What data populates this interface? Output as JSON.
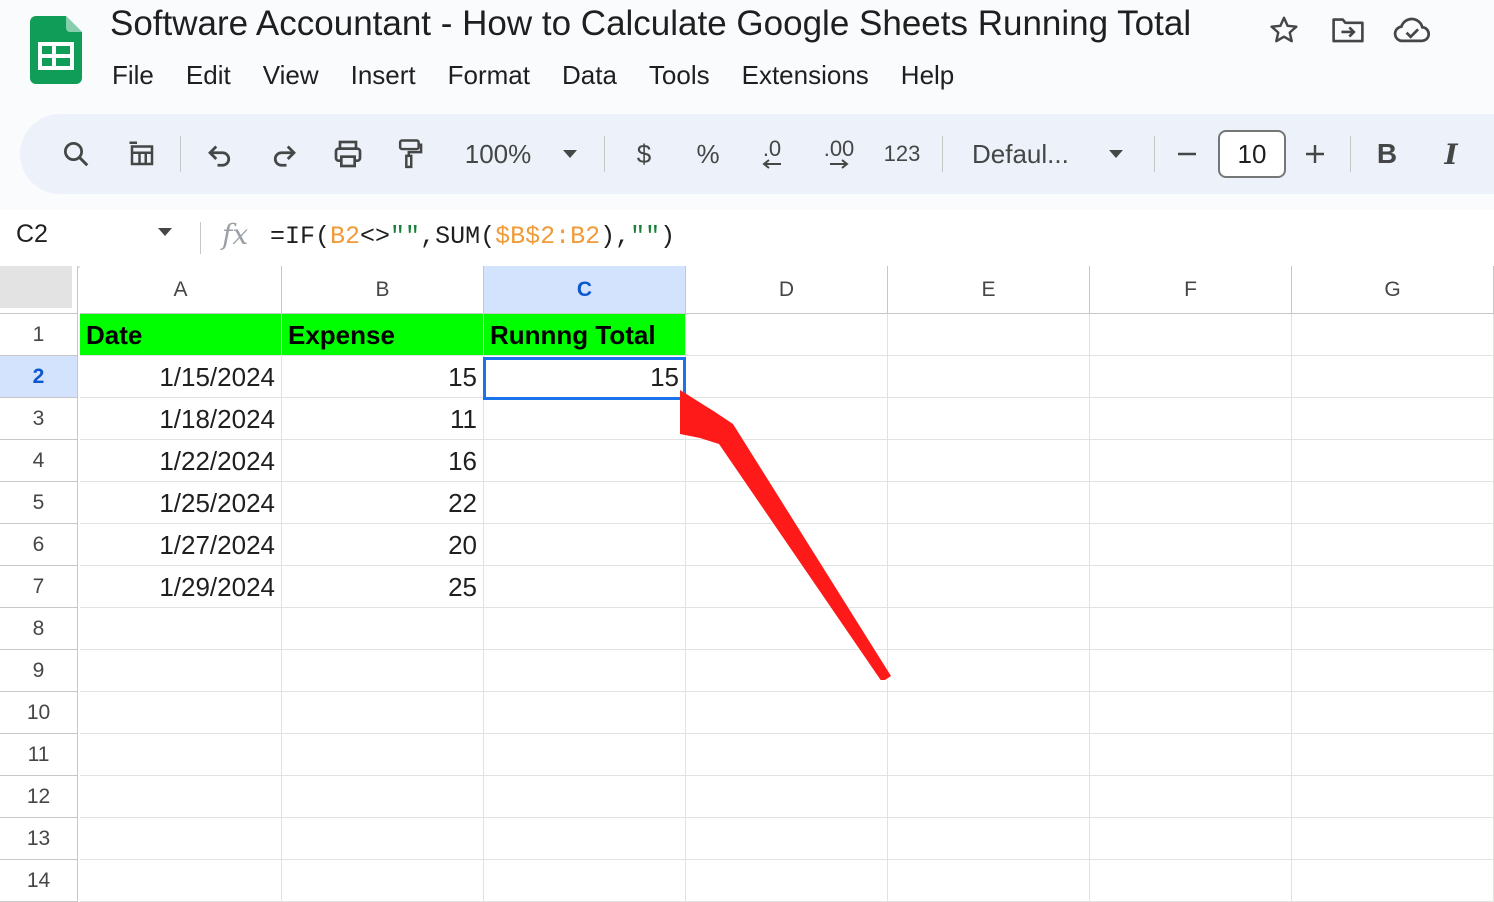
{
  "doc": {
    "title": "Software Accountant - How to Calculate Google Sheets Running Total"
  },
  "menu": [
    "File",
    "Edit",
    "View",
    "Insert",
    "Format",
    "Data",
    "Tools",
    "Extensions",
    "Help"
  ],
  "toolbar": {
    "zoom": "100%",
    "currency": "$",
    "percent": "%",
    "decrease_decimal": ".0",
    "increase_decimal": ".00",
    "more_formats": "123",
    "font": "Defaul...",
    "font_size": "10",
    "bold": "B",
    "italic": "I"
  },
  "formula_bar": {
    "cell_ref": "C2",
    "fx": "fx",
    "formula_parts": [
      "=IF(",
      "B2",
      "<>",
      "\"\"",
      ",SUM(",
      "$B$2:B2",
      "),",
      "\"\"",
      ")"
    ]
  },
  "sheet": {
    "columns": [
      "A",
      "B",
      "C",
      "D",
      "E",
      "F",
      "G"
    ],
    "rows": [
      "1",
      "2",
      "3",
      "4",
      "5",
      "6",
      "7",
      "8",
      "9",
      "10",
      "11",
      "12",
      "13",
      "14"
    ],
    "header_row": [
      "Date",
      "Expense",
      "Runnng Total"
    ],
    "data": [
      [
        "1/15/2024",
        "15",
        "15"
      ],
      [
        "1/18/2024",
        "11",
        ""
      ],
      [
        "1/22/2024",
        "16",
        ""
      ],
      [
        "1/25/2024",
        "22",
        ""
      ],
      [
        "1/27/2024",
        "20",
        ""
      ],
      [
        "1/29/2024",
        "25",
        ""
      ]
    ],
    "active_cell": "C2",
    "header_fill": "#00ff00",
    "selection_color": "#1a73e8"
  },
  "annotation": {
    "arrow_color": "#ff1a1a"
  },
  "icons": {
    "logo": "google-sheets-logo",
    "star": "star-icon",
    "move": "move-to-folder-icon",
    "cloud": "cloud-saved-icon",
    "search": "search-icon",
    "format_table": "table-icon",
    "undo": "undo-icon",
    "redo": "redo-icon",
    "print": "print-icon",
    "paint_format": "paint-format-icon",
    "dropdown": "chevron-down-icon",
    "minus": "minus-icon",
    "plus": "plus-icon"
  }
}
